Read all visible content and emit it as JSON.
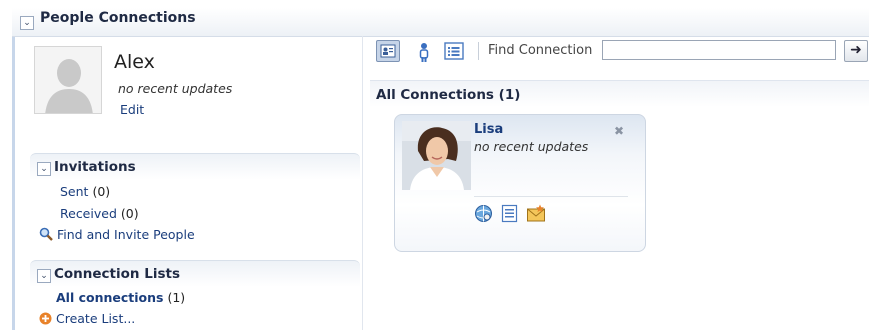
{
  "panel": {
    "title": "People Connections"
  },
  "user": {
    "name": "Alex",
    "status": "no recent updates",
    "edit_label": "Edit"
  },
  "invitations": {
    "title": "Invitations",
    "sent_label": "Sent",
    "sent_count": "(0)",
    "received_label": "Received",
    "received_count": "(0)",
    "find_invite_label": "Find and Invite People"
  },
  "connection_lists": {
    "title": "Connection Lists",
    "all_label": "All connections",
    "all_count": "(1)",
    "create_label": "Create List..."
  },
  "toolbar": {
    "find_label": "Find Connection",
    "find_value": "",
    "icons": [
      "card-view-icon",
      "person-view-icon",
      "list-view-icon"
    ]
  },
  "connections": {
    "header": "All Connections",
    "count": "(1)",
    "cards": [
      {
        "name": "Lisa",
        "status": "no recent updates"
      }
    ]
  },
  "colors": {
    "link": "#1a3d7c",
    "header_text": "#1f2a44",
    "panel_border": "#c7d6ea"
  }
}
